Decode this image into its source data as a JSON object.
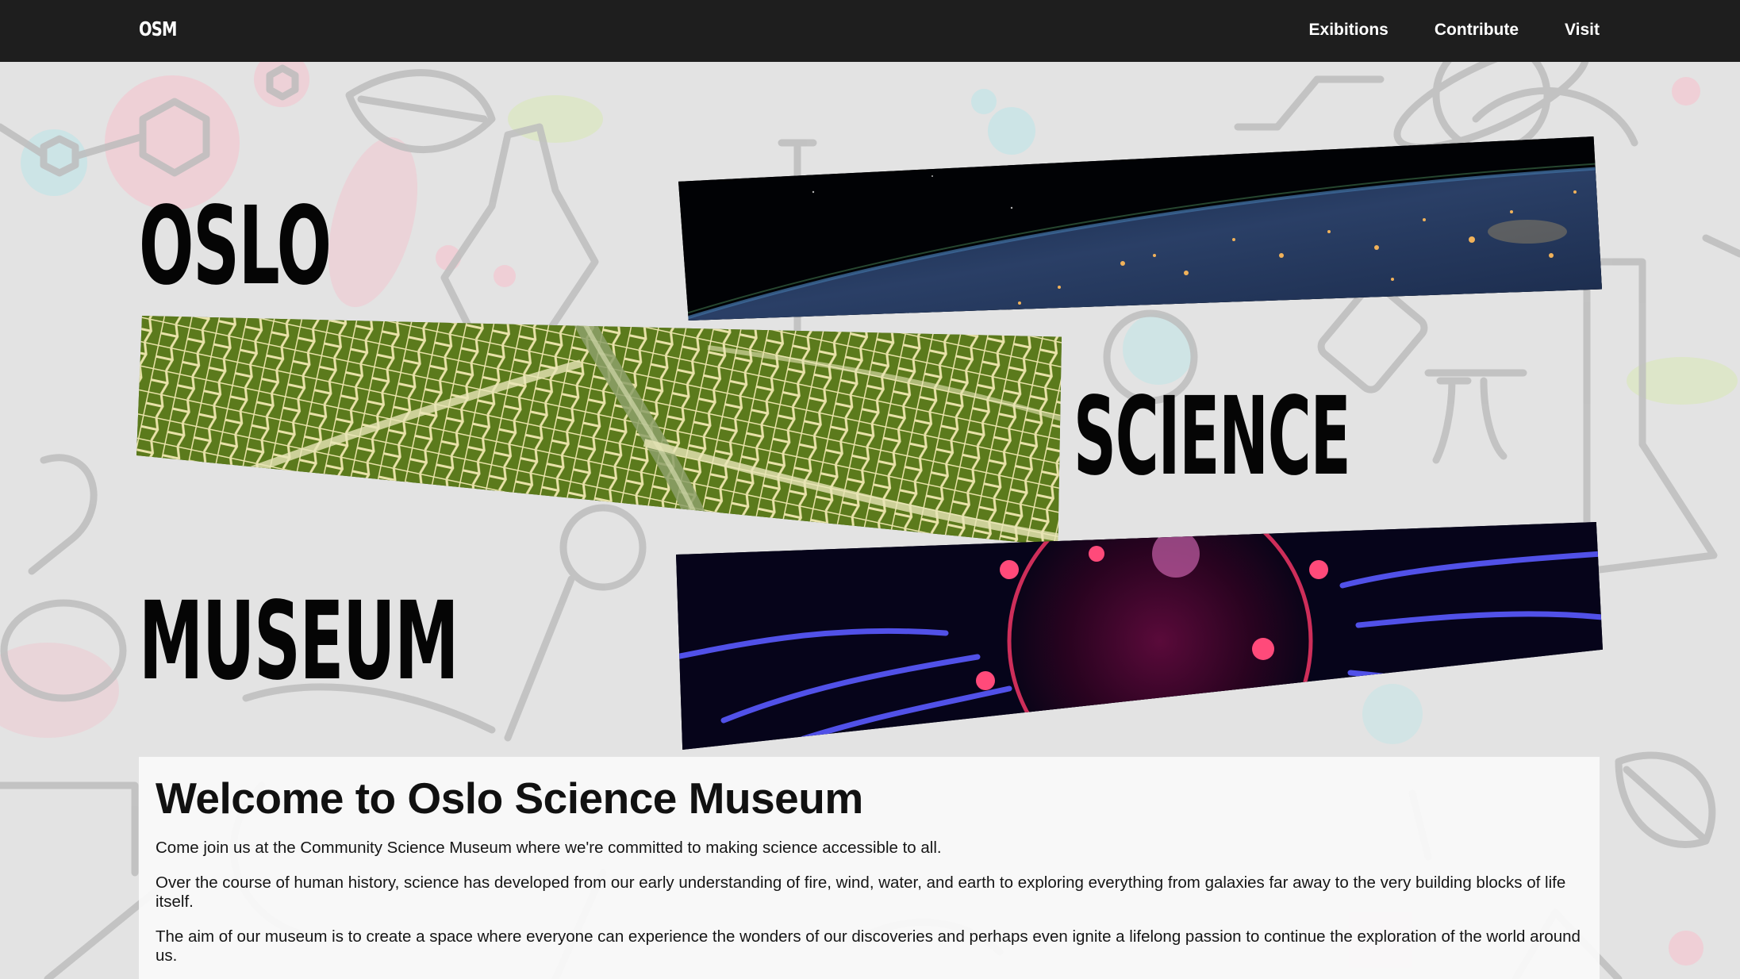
{
  "navbar": {
    "brand": "OSM",
    "links": [
      {
        "label": "Exibitions"
      },
      {
        "label": "Contribute"
      },
      {
        "label": "Visit"
      }
    ]
  },
  "hero": {
    "words": [
      "OSLO",
      "SCIENCE",
      "MUSEUM"
    ],
    "images": [
      {
        "name": "earth-from-space-image"
      },
      {
        "name": "leaf-veins-image"
      },
      {
        "name": "plasma-ball-image"
      }
    ]
  },
  "welcome": {
    "title": "Welcome to Oslo Science Museum",
    "paragraphs": [
      "Come join us at the Community Science Museum where we're committed to making science accessible to all.",
      "Over the course of human history, science has developed from our early understanding of fire, wind, water, and earth to exploring everything from galaxies far away to the very building blocks of life itself.",
      "The aim of our museum is to create a space where everyone can experience the wonders of our discoveries and perhaps even ignite a lifelong passion to continue the exploration of the world around us."
    ]
  },
  "colors": {
    "navbar_bg": "#1e1e1e",
    "page_bg": "#e4e4e4",
    "text": "#050505"
  }
}
